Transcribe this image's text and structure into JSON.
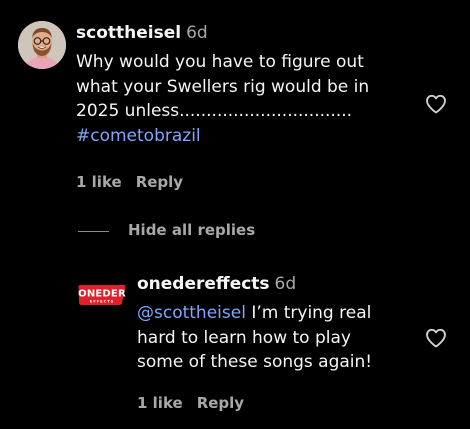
{
  "comment": {
    "username": "scottheisel",
    "time": "6d",
    "text_lines": [
      "Why would you have to figure out",
      "what your Swellers rig would be in",
      "2025 unless................................"
    ],
    "hashtag": "#cometobrazil",
    "likes": "1 like",
    "reply_label": "Reply"
  },
  "hide_replies_label": "Hide all replies",
  "reply": {
    "username": "onedereffects",
    "time": "6d",
    "mention": "@scottheisel",
    "text_first": " I’m trying real",
    "text_lines": [
      "hard to learn how to play",
      "some of these songs again!"
    ],
    "likes": "1 like",
    "reply_label": "Reply",
    "logo_text": "ONEDER",
    "logo_subtext": "EFFECTS"
  },
  "colors": {
    "background": "#000000",
    "primary_text": "#f5f5f5",
    "secondary_text": "#a8a8a8",
    "link": "#7fa7ff",
    "logo_red": "#e0202a"
  },
  "icons": {
    "like": "heart-outline-icon"
  }
}
